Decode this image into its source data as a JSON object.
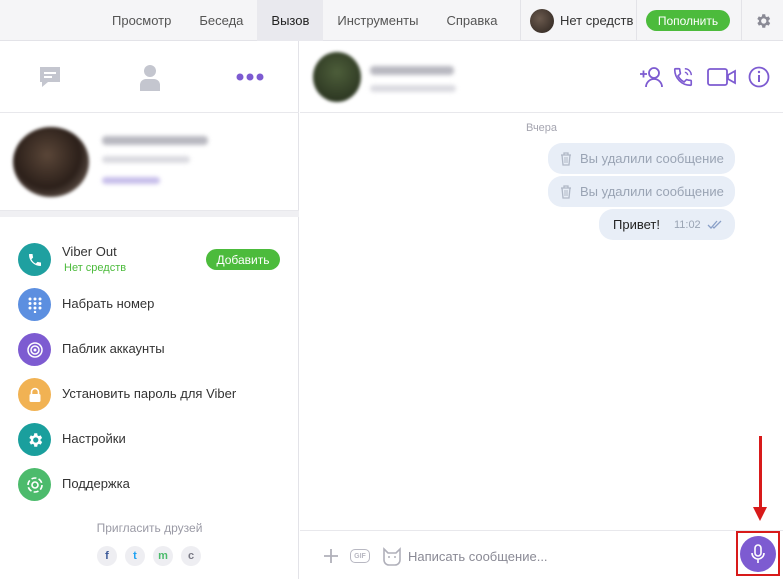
{
  "topbar": {
    "menu": [
      "Просмотр",
      "Беседа",
      "Вызов",
      "Инструменты",
      "Справка"
    ],
    "active_menu": "Вызов",
    "balance_text": "Нет средств",
    "topup_label": "Пополнить",
    "icons": [
      "back-arrow-icon",
      "forward-arrow-icon",
      "gear-icon"
    ]
  },
  "left": {
    "tabs": [
      "chat-bubble-icon",
      "contact-icon",
      "more-dots-icon"
    ],
    "menu_items": [
      {
        "label": "Viber Out",
        "sub": "Нет средств",
        "button": "Добавить",
        "icon": "phone-icon",
        "color": "#1fa0a0"
      },
      {
        "label": "Набрать номер",
        "icon": "dialpad-icon",
        "color": "#5c8fe0"
      },
      {
        "label": "Паблик аккаунты",
        "icon": "public-accounts-icon",
        "color": "#7d5bd1"
      },
      {
        "label": "Установить пароль для Viber",
        "icon": "lock-icon",
        "color": "#f1b253"
      },
      {
        "label": "Настройки",
        "icon": "settings-icon",
        "color": "#1a9f9d"
      },
      {
        "label": "Поддержка",
        "icon": "support-icon",
        "color": "#4cbb6c"
      }
    ],
    "invite_label": "Пригласить друзей",
    "share": [
      "f",
      "t",
      "m",
      "c"
    ]
  },
  "chat": {
    "date_label": "Вчера",
    "deleted_text": "Вы удалили сообщение",
    "message_text": "Привет!",
    "message_time": "11:02",
    "header_icons": [
      "add-contact-icon",
      "call-icon",
      "video-call-icon",
      "info-icon"
    ]
  },
  "composer": {
    "placeholder": "Написать сообщение...",
    "gif_label": "GIF",
    "icons": [
      "plus-icon",
      "gif-icon",
      "sticker-icon",
      "microphone-icon"
    ]
  },
  "colors": {
    "accent_green": "#4cbb3c",
    "viber_purple": "#7d5bd1",
    "highlight_red": "#d81a1a"
  }
}
